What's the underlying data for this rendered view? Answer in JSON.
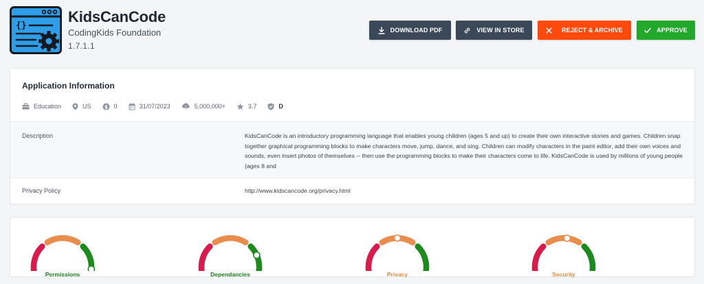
{
  "app": {
    "name": "KidsCanCode",
    "developer": "CodingKids Foundation",
    "version": "1.7.1.1"
  },
  "actions": {
    "download_label": "DOWNLOAD PDF",
    "store_label": "VIEW IN STORE",
    "reject_label": "REJECT & ARCHIVE",
    "approve_label": "APPROVE"
  },
  "info": {
    "title": "Application Information",
    "meta": {
      "category": "Education",
      "country": "US",
      "price": "0",
      "date": "31/07/2023",
      "downloads": "5,000,000+",
      "rating": "3.7",
      "grade": "D"
    },
    "description_label": "Description",
    "description_text": "KidsCanCode is an introductory programming language that enables young children (ages 5 and up) to create their own interactive stories and games. Children snap together graphical programming blocks to make characters move, jump, dance, and sing. Children can modify characters in the paint editor, add their own voices and sounds, even insert photos of themselves -- then use the programming blocks to make their characters come to life. KidsCanCode is used by millions of young people (ages 8 and",
    "privacy_label": "Privacy Policy",
    "privacy_url": "http://www.kidscancode.org/privacy.html"
  },
  "gauges": [
    {
      "label": "Permissions",
      "level": 0.93,
      "color": "#1e7d1e"
    },
    {
      "label": "Dependancies",
      "level": 0.8,
      "color": "#1e7d1e"
    },
    {
      "label": "Privacy",
      "level": 0.5,
      "color": "#e88c3c"
    },
    {
      "label": "Security",
      "level": 0.53,
      "color": "#e88c3c"
    }
  ],
  "colors": {
    "gauge_low": "#d81b4a",
    "gauge_mid": "#e98d4c",
    "gauge_high": "#1d8a1d",
    "reject": "#ff4a0d",
    "approve": "#22a82b",
    "dark_button": "#3a4857"
  }
}
